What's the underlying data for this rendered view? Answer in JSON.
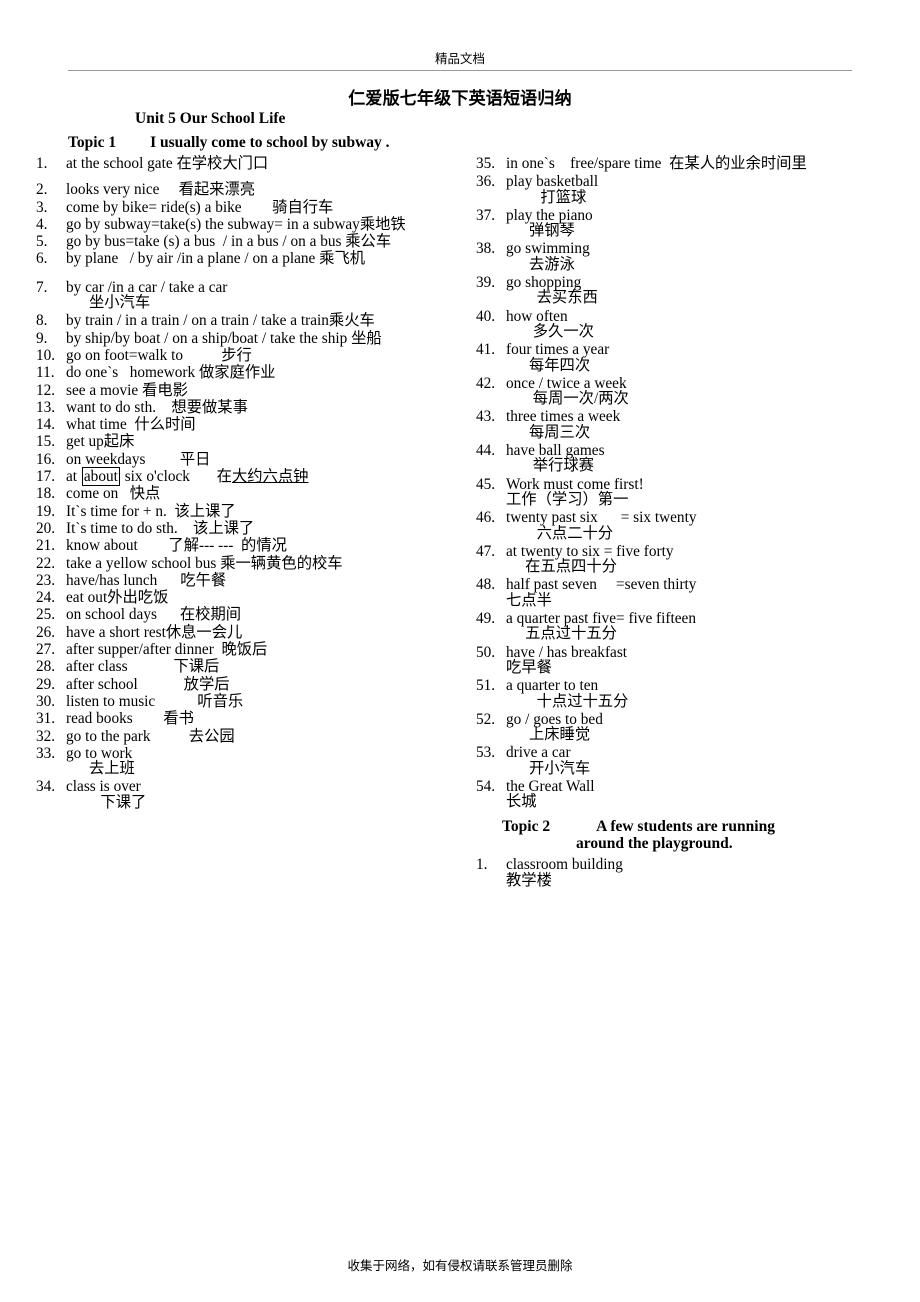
{
  "page": {
    "header_note": "精品文档",
    "footer_note": "收集于网络，如有侵权请联系管理员删除",
    "doc_title": "仁爱版七年级下英语短语归纳",
    "unit_title": "Unit 5 Our School Life",
    "topic1_label": "Topic 1",
    "topic1_text": "I usually come to school by subway ."
  },
  "left_items": [
    {
      "num": "1.",
      "text": "at the school gate 在学校大门口"
    },
    {
      "num": "2.",
      "text": "looks very nice     看起来漂亮"
    },
    {
      "num": "3.",
      "text": "come by bike= ride(s) a bike        骑自行车"
    },
    {
      "num": "4.",
      "text": "go by subway=take(s) the subway= in a subway乘地铁"
    },
    {
      "num": "5.",
      "text": "go by bus=take (s) a bus  / in a bus / on a bus 乘公车"
    },
    {
      "num": "6.",
      "text": "by plane   / by air /in a plane / on a plane 乘飞机"
    },
    {
      "num": "7.",
      "text": "by car /in a car / take a car\n      坐小汽车"
    },
    {
      "num": "8.",
      "text": "by train / in a train / on a train / take a train乘火车"
    },
    {
      "num": "9.",
      "text": "by ship/by boat / on a ship/boat / take the ship 坐船"
    },
    {
      "num": "10.",
      "text": "go on foot=walk to          步行"
    },
    {
      "num": "11.",
      "text": "do one`s   homework 做家庭作业"
    },
    {
      "num": "12.",
      "text": "see a movie 看电影"
    },
    {
      "num": "13.",
      "text": "want to do sth.    想要做某事"
    },
    {
      "num": "14.",
      "text": "what time  什么时间"
    },
    {
      "num": "15.",
      "text": "get up起床"
    },
    {
      "num": "16.",
      "text": "on weekdays         平日"
    },
    {
      "num": "17.",
      "text": "at |about| six o'clock        在大约六点钟"
    },
    {
      "num": "18.",
      "text": "come on   快点"
    },
    {
      "num": "19.",
      "text": "It`s time for + n.  该上课了"
    },
    {
      "num": "20.",
      "text": "It`s time to do sth.    该上课了"
    },
    {
      "num": "21.",
      "text": "know about        了解--- ---  的情况"
    },
    {
      "num": "22.",
      "text": "take a yellow school bus 乘一辆黄色的校车"
    },
    {
      "num": "23.",
      "text": "have/has lunch      吃午餐"
    },
    {
      "num": "24.",
      "text": "eat out外出吃饭"
    },
    {
      "num": "25.",
      "text": "on school days      在校期间"
    },
    {
      "num": "26.",
      "text": "have a short rest休息一会儿"
    },
    {
      "num": "27.",
      "text": "after supper/after dinner  晚饭后"
    },
    {
      "num": "28.",
      "text": "after class            下课后"
    },
    {
      "num": "29.",
      "text": "after school            放学后"
    },
    {
      "num": "30.",
      "text": "listen to music           听音乐"
    },
    {
      "num": "31.",
      "text": "read books        看书"
    },
    {
      "num": "32.",
      "text": "go to the park          去公园"
    },
    {
      "num": "33.",
      "text": "go to work\n      去上班"
    },
    {
      "num": "34.",
      "text": "class is over\n         下课了"
    }
  ],
  "right_items": [
    {
      "num": "35.",
      "text": "in one`s    free/spare time  在某人的业余时间里"
    },
    {
      "num": "36.",
      "text": "play basketball\n         打篮球"
    },
    {
      "num": "37.",
      "text": "play the piano\n      弹钢琴"
    },
    {
      "num": "38.",
      "text": "go swimming\n      去游泳"
    },
    {
      "num": "39.",
      "text": "go shopping\n        去买东西"
    },
    {
      "num": "40.",
      "text": "how often\n       多久一次"
    },
    {
      "num": "41.",
      "text": "four times a year\n      每年四次"
    },
    {
      "num": "42.",
      "text": "once / twice a week\n       每周一次/两次"
    },
    {
      "num": "43.",
      "text": "three times a week\n      每周三次"
    },
    {
      "num": "44.",
      "text": "have ball games\n       举行球赛"
    },
    {
      "num": "45.",
      "text": "Work must come first!\n工作（学习）第一"
    },
    {
      "num": "46.",
      "text": "twenty past six      = six twenty\n        六点二十分"
    },
    {
      "num": "47.",
      "text": "at twenty to six = five forty\n     在五点四十分"
    },
    {
      "num": "48.",
      "text": "half past seven     =seven thirty\n七点半"
    },
    {
      "num": "49.",
      "text": "a quarter past five= five fifteen\n     五点过十五分"
    },
    {
      "num": "50.",
      "text": "have / has breakfast\n吃早餐"
    },
    {
      "num": "51.",
      "text": "a quarter to ten\n        十点过十五分"
    },
    {
      "num": "52.",
      "text": "go / goes to bed\n      上床睡觉"
    },
    {
      "num": "53.",
      "text": "drive a car\n      开小汽车"
    },
    {
      "num": "54.",
      "text": "the Great Wall\n长城"
    }
  ],
  "topic2": {
    "label": "Topic 2",
    "text_line1": "A few students are running",
    "text_line2": "around the playground.",
    "items": [
      {
        "num": "1.",
        "text": "classroom building\n教学楼"
      }
    ]
  }
}
